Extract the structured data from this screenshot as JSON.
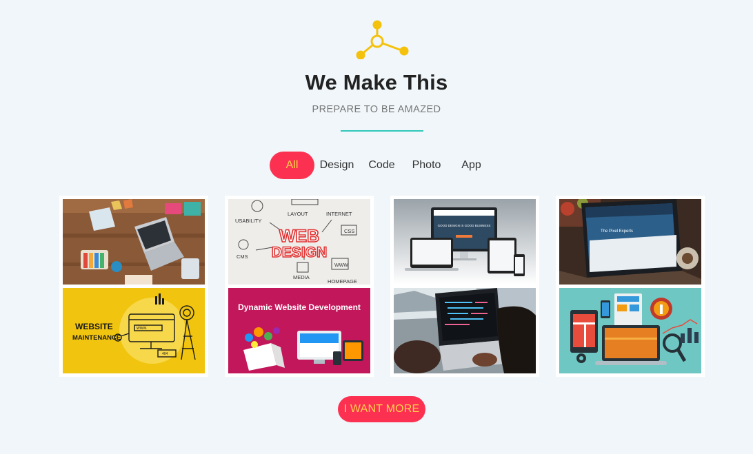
{
  "header": {
    "title": "We Make This",
    "subtitle": "PREPARE TO BE AMAZED"
  },
  "filters": [
    {
      "label": "All",
      "active": true
    },
    {
      "label": "Design",
      "active": false
    },
    {
      "label": "Code",
      "active": false
    },
    {
      "label": "Photo",
      "active": false
    },
    {
      "label": "App",
      "active": false
    }
  ],
  "gallery": {
    "items": [
      {
        "image": "desk-laptop-workspace"
      },
      {
        "image": "web-design-sketch",
        "text_main": "WEB",
        "text_sub": "DESIGN",
        "labels": [
          "USABILITY",
          "LAYOUT",
          "INTERNET",
          "CSS",
          "CMS",
          "MEDIA",
          "HOMEPAGE",
          "WWW"
        ]
      },
      {
        "image": "responsive-devices-mockup",
        "text_main": "GOOD DESIGN IS GOOD BUSINESS"
      },
      {
        "image": "laptop-website-photo",
        "text_main": "The Pixel Experts"
      },
      {
        "image": "website-maintenance",
        "text_main": "WEBSITE",
        "text_sub": "MAINTENANCE",
        "labels": [
          "WWW.",
          "404"
        ]
      },
      {
        "image": "dynamic-website-development",
        "text_main": "Dynamic Website Development"
      },
      {
        "image": "coding-laptop-photo"
      },
      {
        "image": "analytics-devices-illustration"
      }
    ]
  },
  "actions": {
    "more_label": "I WANT MORE"
  },
  "colors": {
    "accent": "#fc3152",
    "accent_text": "#ffd24a",
    "logo": "#f4c20d",
    "divider": "#2ec8b8",
    "background": "#f0f6f9"
  },
  "icons": {
    "logo": "share-nodes-icon"
  }
}
